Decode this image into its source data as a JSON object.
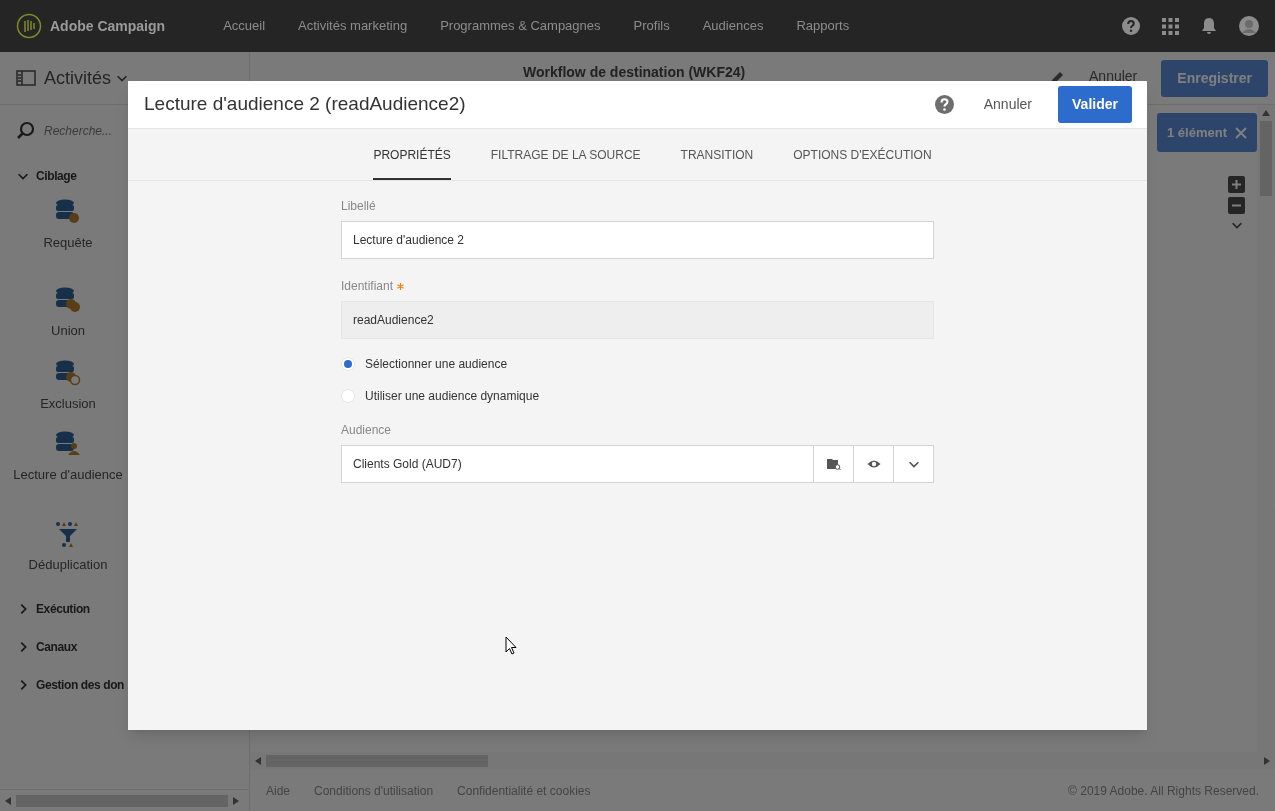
{
  "top_nav": {
    "brand": "Adobe Campaign",
    "items": [
      "Accueil",
      "Activités marketing",
      "Programmes & Campagnes",
      "Profils",
      "Audiences",
      "Rapports"
    ]
  },
  "toolbar": {
    "panel_title": "Activités",
    "workflow_title": "Workflow de destination (WKF24)",
    "cancel": "Annuler",
    "save": "Enregistrer"
  },
  "sidebar": {
    "search_placeholder": "Recherche...",
    "sections": [
      {
        "label": "Ciblage",
        "expanded": true,
        "children": [
          {
            "label": "Requête",
            "kind": "query"
          },
          {
            "label": "Union",
            "kind": "union"
          },
          {
            "label": "Exclusion",
            "kind": "exclusion"
          },
          {
            "label": "Lecture d'audience",
            "kind": "audience"
          },
          {
            "label": "Déduplication",
            "kind": "dedup"
          }
        ]
      },
      {
        "label": "Exécution",
        "expanded": false
      },
      {
        "label": "Canaux",
        "expanded": false
      },
      {
        "label": "Gestion des don",
        "expanded": false
      }
    ]
  },
  "canvas": {
    "selection_button": "1 élément"
  },
  "footer": {
    "links": [
      "Aide",
      "Conditions d'utilisation",
      "Confidentialité et cookies"
    ],
    "copyright": "© 2019 Adobe. All Rights Reserved."
  },
  "dialog": {
    "title": "Lecture d'audience 2 (readAudience2)",
    "cancel": "Annuler",
    "confirm": "Valider",
    "tabs": [
      {
        "label": "PROPRIÉTÉS",
        "selected": true
      },
      {
        "label": "FILTRAGE DE LA SOURCE",
        "selected": false
      },
      {
        "label": "TRANSITION",
        "selected": false
      },
      {
        "label": "OPTIONS D'EXÉCUTION",
        "selected": false
      }
    ],
    "fields": [
      {
        "label": "Libellé",
        "value": "Lecture d'audience 2",
        "required": false,
        "disabled": false
      },
      {
        "label": "Identifiant",
        "value": "readAudience2",
        "required": true,
        "disabled": true
      }
    ],
    "audience_mode": [
      {
        "label": "Sélectionner une audience",
        "selected": true
      },
      {
        "label": "Utiliser une audience dynamique",
        "selected": false
      }
    ],
    "audience": {
      "label": "Audience",
      "value": "Clients Gold (AUD7)"
    }
  }
}
